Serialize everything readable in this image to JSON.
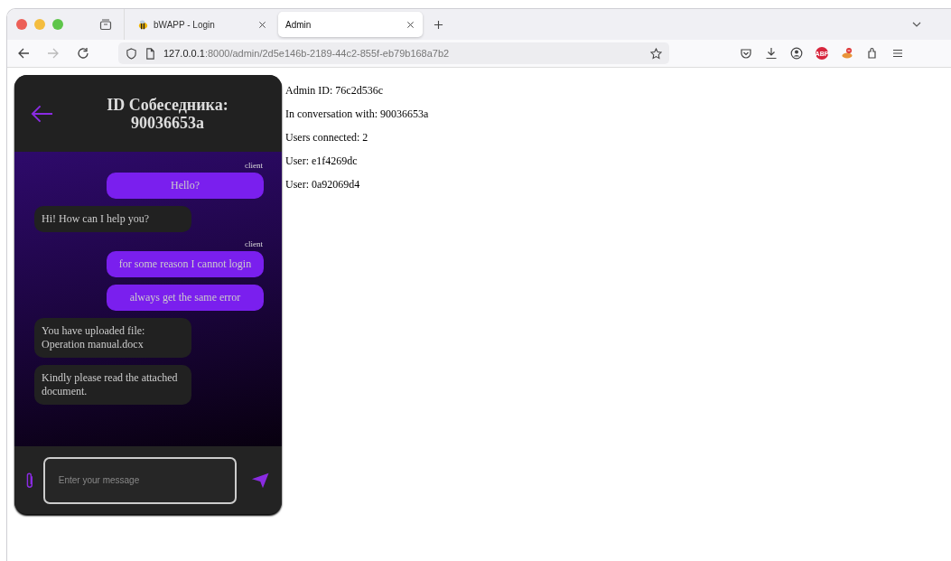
{
  "browser": {
    "tabs": [
      {
        "label": "bWAPP - Login",
        "selected": false,
        "kind": "bee"
      },
      {
        "label": "Admin",
        "selected": true,
        "kind": "plain"
      }
    ],
    "address": {
      "host": "127.0.0.1",
      "rest": ":8000/admin/2d5e146b-2189-44c2-855f-eb79b168a7b2"
    },
    "extensions": [
      {
        "kind": "badge",
        "label": "ABP"
      },
      {
        "kind": "fox"
      }
    ]
  },
  "chat": {
    "title": "ID Собеседника: 90036653a",
    "messages": [
      {
        "kind": "outgoing",
        "sender": "client",
        "text": "Hello?"
      },
      {
        "kind": "incoming",
        "text": "Hi! How can I help you?"
      },
      {
        "kind": "outgoing",
        "sender": "client",
        "text": "for some reason I cannot login"
      },
      {
        "kind": "outgoing",
        "text": "always get the same error"
      },
      {
        "kind": "incoming",
        "text": "You have uploaded file: Operation manual.docx"
      },
      {
        "kind": "incoming",
        "text": "Kindly please read the attached document."
      }
    ],
    "input": {
      "placeholder": "Enter your message"
    }
  },
  "info": [
    "Admin ID: 76c2d536c",
    "In conversation with: 90036653a",
    "Users connected: 2",
    "User: e1f4269dc",
    "User: 0a92069d4"
  ]
}
